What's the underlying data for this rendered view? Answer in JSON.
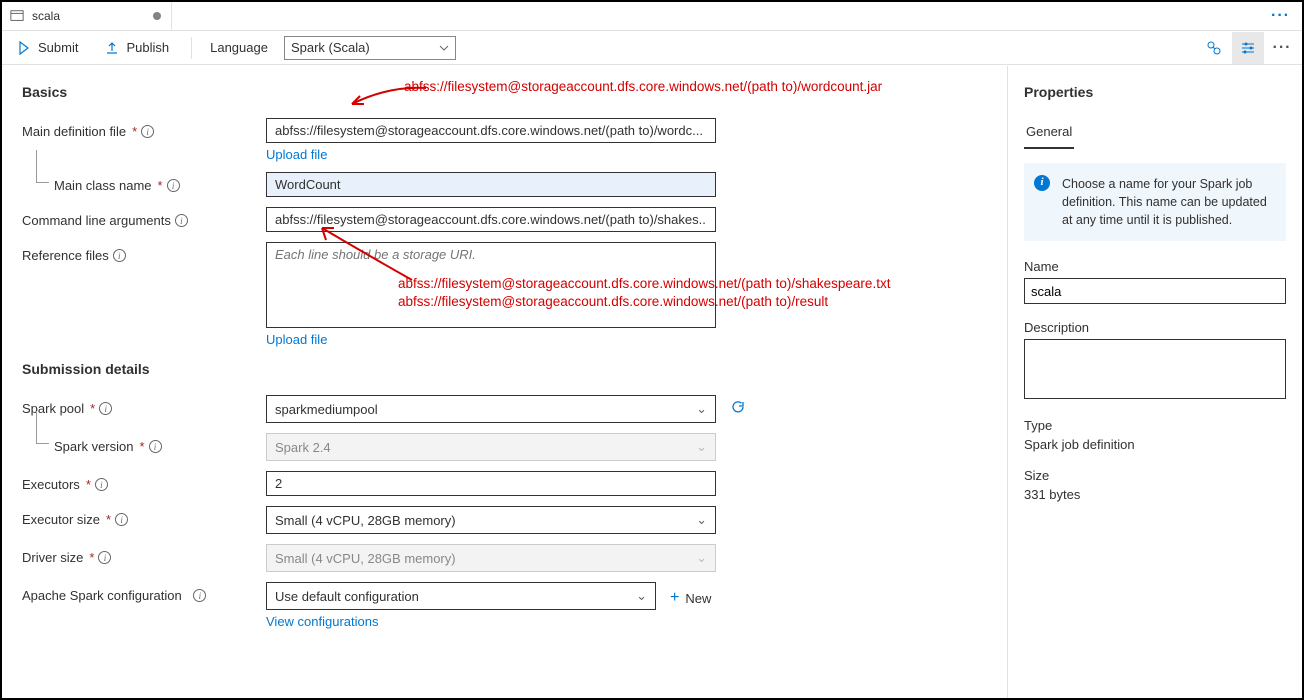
{
  "tab": {
    "title": "scala"
  },
  "toolbar": {
    "submit": "Submit",
    "publish": "Publish",
    "language_label": "Language",
    "language_value": "Spark (Scala)"
  },
  "sections": {
    "basics": "Basics",
    "submission": "Submission details"
  },
  "labels": {
    "main_def": "Main definition file",
    "main_class": "Main class name",
    "cmd_args": "Command line arguments",
    "ref_files": "Reference files",
    "spark_pool": "Spark pool",
    "spark_version": "Spark version",
    "executors": "Executors",
    "executor_size": "Executor size",
    "driver_size": "Driver size",
    "spark_conf": "Apache Spark configuration"
  },
  "values": {
    "main_def": "abfss://filesystem@storageaccount.dfs.core.windows.net/(path to)/wordc...",
    "main_class": "WordCount",
    "cmd_args": "abfss://filesystem@storageaccount.dfs.core.windows.net/(path to)/shakes...",
    "ref_placeholder": "Each line should be a storage URI.",
    "spark_pool": "sparkmediumpool",
    "spark_version": "Spark 2.4",
    "executors": "2",
    "executor_size": "Small (4 vCPU, 28GB memory)",
    "driver_size": "Small (4 vCPU, 28GB memory)",
    "spark_conf": "Use default configuration"
  },
  "links": {
    "upload": "Upload file",
    "view_conf": "View configurations",
    "new": "New"
  },
  "props": {
    "title": "Properties",
    "tab_general": "General",
    "info": "Choose a name for your Spark job definition. This name can be updated at any time until it is published.",
    "name_label": "Name",
    "name_value": "scala",
    "desc_label": "Description",
    "type_label": "Type",
    "type_value": "Spark job definition",
    "size_label": "Size",
    "size_value": "331 bytes"
  },
  "annotations": {
    "a1": "abfss://filesystem@storageaccount.dfs.core.windows.net/(path to)/wordcount.jar",
    "a2": "abfss://filesystem@storageaccount.dfs.core.windows.net/(path to)/shakespeare.txt",
    "a3": "abfss://filesystem@storageaccount.dfs.core.windows.net/(path to)/result"
  }
}
